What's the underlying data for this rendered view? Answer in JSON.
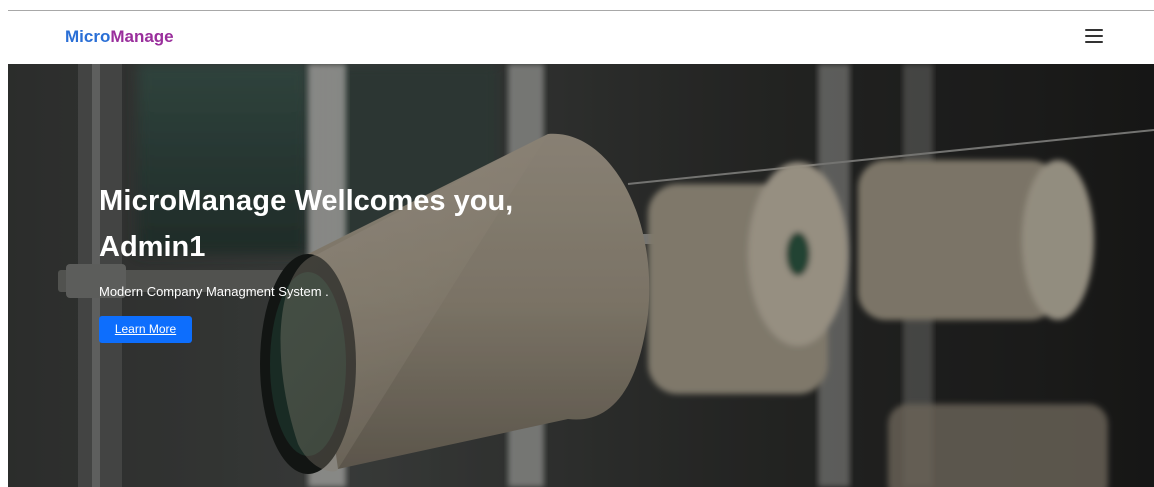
{
  "navbar": {
    "brand_part1": "Micro",
    "brand_part2": "Manage",
    "menu_icon": "hamburger-menu-icon"
  },
  "hero": {
    "title_strong": "MicroManage",
    "title_rest": " Wellcomes you, Admin1",
    "subtitle": "Modern Company Managment System .",
    "button_label": "Learn More",
    "background": "textile-thread-spools-photo"
  },
  "colors": {
    "brand_blue": "#2a6fd6",
    "brand_purple": "#9a2f9c",
    "button_blue": "#0d6efd"
  }
}
